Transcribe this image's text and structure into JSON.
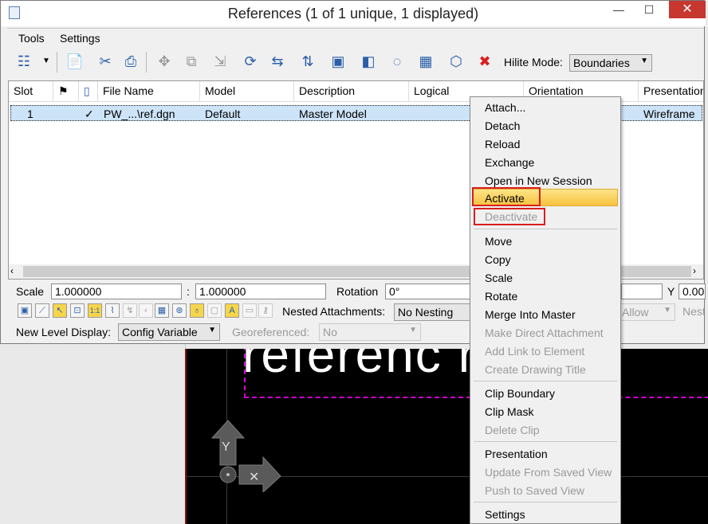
{
  "window": {
    "title": "References (1 of 1 unique, 1 displayed)",
    "minimize": "—",
    "maximize": "☐",
    "close": "✕"
  },
  "menu": {
    "tools": "Tools",
    "settings": "Settings"
  },
  "toolbar": {
    "hilite_label": "Hilite Mode:",
    "hilite_value": "Boundaries"
  },
  "table": {
    "columns": [
      "Slot",
      "",
      "",
      "File Name",
      "Model",
      "Description",
      "Logical",
      "Orientation",
      "Presentation"
    ],
    "rows": [
      {
        "slot": "1",
        "check": "✓",
        "file": "PW_...\\ref.dgn",
        "model": "Default",
        "description": "Master Model",
        "logical": "",
        "orientation": "",
        "presentation": "Wireframe"
      }
    ]
  },
  "controls": {
    "scale_label": "Scale",
    "scale_x": "1.000000",
    "scale_sep": ":",
    "scale_y": "1.000000",
    "rotation_label": "Rotation",
    "rotation_value": "0°",
    "y_label": "Y",
    "y_value": "0.00",
    "nested_label": "Nested Attachments:",
    "nested_value": "No Nesting",
    "allow_value": "Allow",
    "nest_value": "Nest",
    "new_level_label": "New Level Display:",
    "new_level_value": "Config Variable",
    "georef_label": "Georeferenced:",
    "georef_value": "No"
  },
  "context_menu": {
    "group1": [
      "Attach...",
      "Detach",
      "Reload",
      "Exchange",
      "Open in New Session",
      "Activate",
      "Deactivate"
    ],
    "group2": [
      "Move",
      "Copy",
      "Scale",
      "Rotate",
      "Merge Into Master",
      "Make Direct Attachment",
      "Add Link to Element",
      "Create Drawing Title"
    ],
    "group3": [
      "Clip Boundary",
      "Clip Mask",
      "Delete Clip"
    ],
    "group4": [
      "Presentation",
      "Update From Saved View",
      "Push to Saved View"
    ],
    "group5": [
      "Settings"
    ]
  },
  "canvas": {
    "text": "referenc    rt    r"
  },
  "colors": {
    "highlight_row": "#cde3f7",
    "activate_highlight": "#f6c23d",
    "annotation_box": "#d81e1e",
    "canvas_bg": "#000000",
    "frame": "#d000d0"
  }
}
